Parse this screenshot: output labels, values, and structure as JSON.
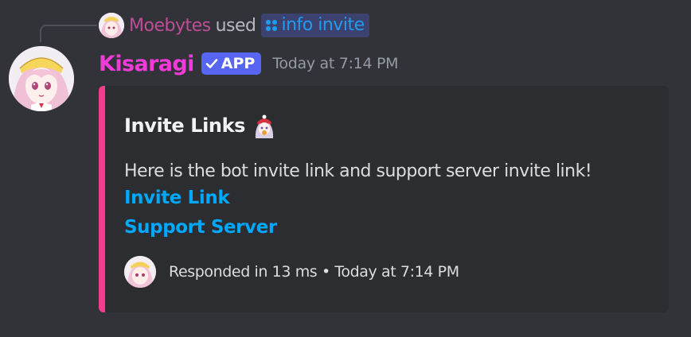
{
  "reply": {
    "username": "Moebytes",
    "action": "used",
    "command": "info invite"
  },
  "author": {
    "name": "Kisaragi",
    "badge": "APP",
    "timestamp": "Today at 7:14 PM"
  },
  "embed": {
    "accent_color": "#f03e8d",
    "title": "Invite Links",
    "title_emoji": "anime-girl-emoji",
    "description": "Here is the bot invite link and support server invite link!",
    "links": [
      "Invite Link",
      "Support Server"
    ],
    "footer": {
      "responded": "Responded in 13 ms",
      "separator": "•",
      "timestamp": "Today at 7:14 PM"
    }
  },
  "colors": {
    "background": "#313338",
    "username": "#f03bd9",
    "reply_username": "#c04d97",
    "app_badge": "#5865f2",
    "link": "#00a8fc"
  }
}
